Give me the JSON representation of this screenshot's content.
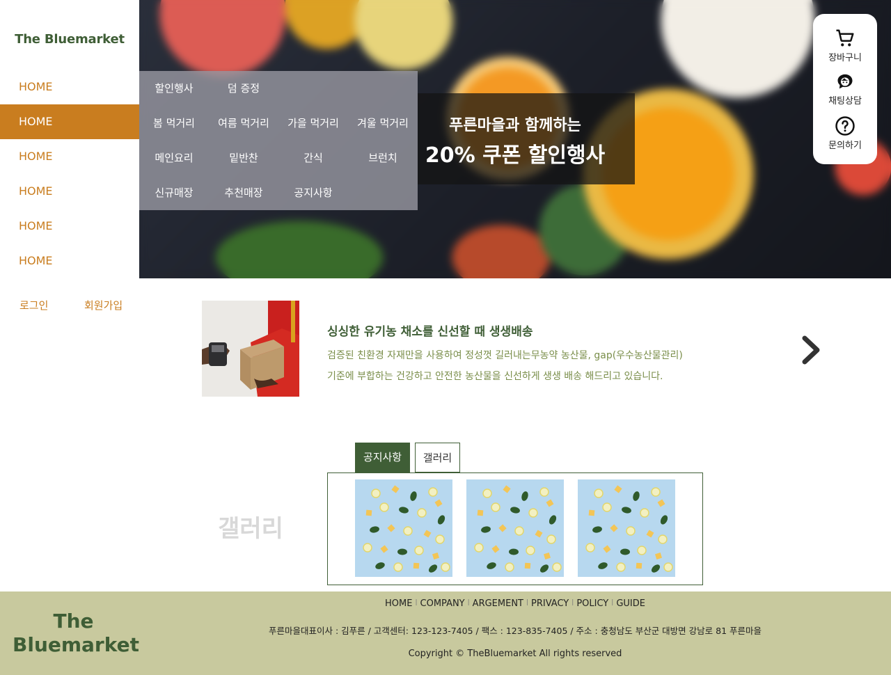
{
  "brand": {
    "logo": "The Bluemarket",
    "accent": "#c97d1f",
    "green": "#3f5e36"
  },
  "sidebar": {
    "nav": [
      "HOME",
      "HOME",
      "HOME",
      "HOME",
      "HOME",
      "HOME"
    ],
    "active_index": 1,
    "login": "로그인",
    "signup": "회원가입"
  },
  "mega_menu": {
    "rows": [
      [
        "할인행사",
        "덤 증정"
      ],
      [
        "봄 먹거리",
        "여름 먹거리",
        "가을 먹거리",
        "겨울 먹거리"
      ],
      [
        "메인요리",
        "밑반찬",
        "간식",
        "브런치"
      ],
      [
        "신규매장",
        "추천매장",
        "공지사항"
      ]
    ]
  },
  "promo": {
    "line1": "푸른마을과 함께하는",
    "line2": "20% 쿠폰 할인행사"
  },
  "quick_menu": [
    {
      "label": "장바구니",
      "icon": "cart-icon"
    },
    {
      "label": "채팅상담",
      "icon": "chat-support-icon"
    },
    {
      "label": "문의하기",
      "icon": "question-icon"
    }
  ],
  "intro": {
    "title": "싱싱한 유기농 채소를 신선할 때 생생배송",
    "line1": "검증된 친환경 자재만을 사용하여 정성껏 길러내는무농약 농산물, gap(우수농산물관리)",
    "line2": "기준에 부합하는 건강하고 안전한 농산물을 신선하게 생생 배송 해드리고 있습니다.",
    "next_icon": "chevron-right-icon"
  },
  "tabs": {
    "notice": "공지사항",
    "gallery": "갤러리",
    "active": "notice"
  },
  "gallery": {
    "section_label": "갤러리",
    "count": 3
  },
  "footer": {
    "logo_line1": "The",
    "logo_line2": "Bluemarket",
    "links": [
      "HOME",
      "COMPANY",
      "ARGEMENT",
      "PRIVACY",
      "POLICY",
      "GUIDE"
    ],
    "info": "푸른마을대표이사 : 김푸른 / 고객센터: 123-123-7405 / 팩스 : 123-835-7405  / 주소 : 충청남도 부산군 대방면 강남로 81 푸른마을",
    "copyright": "Copyright © TheBluemarket All rights reserved"
  }
}
